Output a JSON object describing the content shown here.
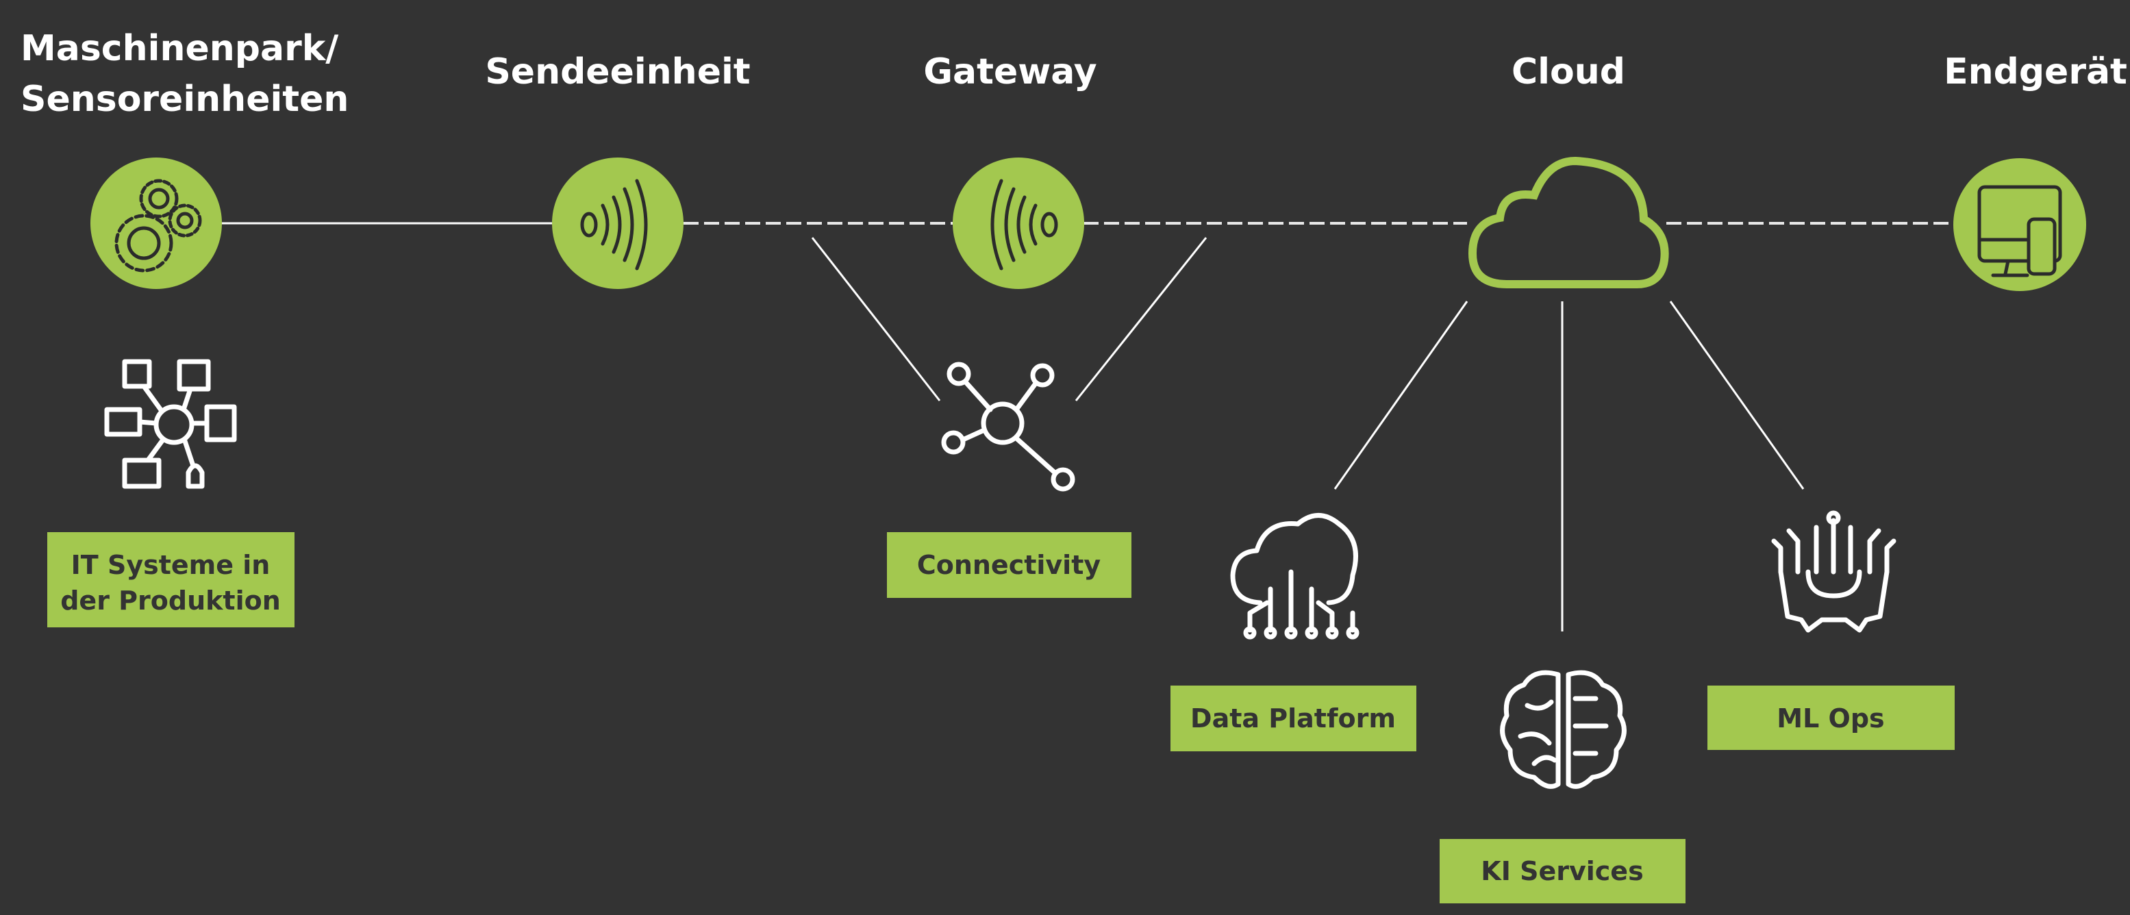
{
  "colors": {
    "background": "#333333",
    "accent": "#a3c84f",
    "line": "#ffffff",
    "box_text": "#333333"
  },
  "stages": [
    {
      "title_line1": "Maschinenpark/",
      "title_line2": "Sensoreinheiten",
      "icon": "gears-icon"
    },
    {
      "title": "Sendeeinheit",
      "icon": "signal-emitter-icon"
    },
    {
      "title": "Gateway",
      "icon": "signal-receiver-icon"
    },
    {
      "title": "Cloud",
      "icon": "cloud-icon"
    },
    {
      "title": "Endgerät",
      "icon": "devices-icon"
    }
  ],
  "components": [
    {
      "label_line1": "IT Systeme in",
      "label_line2": "der Produktion",
      "icon": "it-systems-hub-icon"
    },
    {
      "label": "Connectivity",
      "icon": "network-hub-icon"
    },
    {
      "label": "Data Platform",
      "icon": "cloud-circuit-icon"
    },
    {
      "label": "KI Services",
      "icon": "ai-brain-icon"
    },
    {
      "label": "ML Ops",
      "icon": "gear-circuit-icon"
    }
  ]
}
